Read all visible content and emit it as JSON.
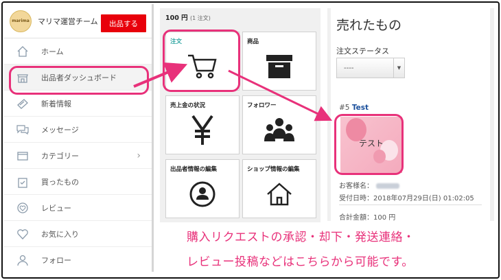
{
  "left_nav": {
    "shop_name": "マリマ運営チーム",
    "sell_button": "出品する",
    "items": [
      {
        "label": "ホーム",
        "icon": "home-icon"
      },
      {
        "label": "出品者ダッシュボード",
        "icon": "shop-icon"
      },
      {
        "label": "新着情報",
        "icon": "news-icon"
      },
      {
        "label": "メッセージ",
        "icon": "chat-icon"
      },
      {
        "label": "カテゴリー",
        "icon": "category-icon"
      },
      {
        "label": "買ったもの",
        "icon": "bag-icon"
      },
      {
        "label": "レビュー",
        "icon": "review-icon"
      },
      {
        "label": "お気に入り",
        "icon": "heart-icon"
      },
      {
        "label": "フォロー",
        "icon": "user-icon"
      }
    ]
  },
  "dashboard": {
    "amount": "100 円",
    "amount_sub": "(1 注文)",
    "tiles": [
      {
        "label": "注文",
        "icon": "cart-icon"
      },
      {
        "label": "商品",
        "icon": "box-icon"
      },
      {
        "label": "売上金の状況",
        "icon": "yen-icon"
      },
      {
        "label": "フォロワー",
        "icon": "followers-icon"
      },
      {
        "label": "出品者情報の編集",
        "icon": "profile-icon"
      },
      {
        "label": "ショップ情報の編集",
        "icon": "house-icon"
      }
    ]
  },
  "sold": {
    "title": "売れたもの",
    "status_label": "注文ステータス",
    "status_value": "----",
    "order_number": "#5",
    "order_name": "Test",
    "thumbnail_text": "テスト",
    "customer_label": "お客様名：",
    "received_label": "受付日時：",
    "received_value": "2018年07月29日(日) 01:02:05",
    "total_label": "合計金額：",
    "total_value": "100 円"
  },
  "caption": {
    "line1": "購入リクエストの承認・却下・発送連絡・",
    "line2": "レビュー投稿などはこちらから可能です。"
  },
  "colors": {
    "highlight": "#e8317a",
    "sell_button": "#e8000b",
    "order_link": "#1a4f9c",
    "tile_active_label": "#2aa3a0"
  }
}
